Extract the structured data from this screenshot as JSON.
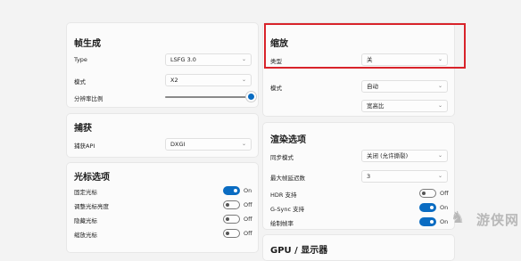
{
  "frame_gen": {
    "title": "帧生成",
    "type_label": "Type",
    "type_value": "LSFG 3.0",
    "mode_label": "模式",
    "mode_value": "X2",
    "resolution_label": "分辨率比例",
    "resolution_fraction": 1.0
  },
  "capture": {
    "title": "捕获",
    "api_label": "捕获API",
    "api_value": "DXGI"
  },
  "cursor": {
    "title": "光标选项",
    "items": [
      {
        "label": "固定光标",
        "state": "On",
        "on": true
      },
      {
        "label": "调整光标亮度",
        "state": "Off",
        "on": false
      },
      {
        "label": "隐藏光标",
        "state": "Off",
        "on": false
      },
      {
        "label": "缩放光标",
        "state": "Off",
        "on": false
      }
    ]
  },
  "scaling": {
    "title": "缩放",
    "type_label": "类型",
    "type_value": "关",
    "mode_label": "模式",
    "mode_value": "自动",
    "extra_value": "宽高比"
  },
  "render": {
    "title": "渲染选项",
    "sync_label": "同步模式",
    "sync_value": "关闭 (允许撕裂)",
    "max_frames_label": "最大帧延迟数",
    "max_frames_value": "3",
    "hdr_label": "HDR 支持",
    "hdr_state": "Off",
    "gsync_label": "G-Sync 支持",
    "gsync_state": "On",
    "draw_fps_label": "绘制帧率",
    "draw_fps_state": "On"
  },
  "gpu": {
    "title": "GPU / 显示器"
  },
  "watermark": {
    "text": "游侠网"
  },
  "colors": {
    "accent": "#0a6cc2",
    "highlight": "#d8232a"
  }
}
